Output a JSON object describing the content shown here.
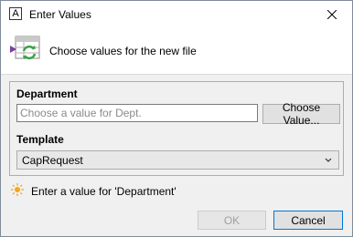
{
  "window": {
    "title": "Enter Values",
    "app_icon_letter": "A"
  },
  "header": {
    "text": "Choose values for the new file",
    "icon": "template-refresh-icon"
  },
  "form": {
    "department": {
      "label": "Department",
      "placeholder": "Choose a value for Dept.",
      "value": "",
      "choose_button": "Choose Value..."
    },
    "template": {
      "label": "Template",
      "selected": "CapRequest"
    }
  },
  "status": {
    "message": "Enter a value for 'Department'",
    "icon": "sun-warning-icon"
  },
  "buttons": {
    "ok": "OK",
    "cancel": "Cancel"
  },
  "colors": {
    "accent_purple": "#7a3fa0",
    "accent_green": "#3aa04a",
    "focus_blue": "#0078d7"
  }
}
